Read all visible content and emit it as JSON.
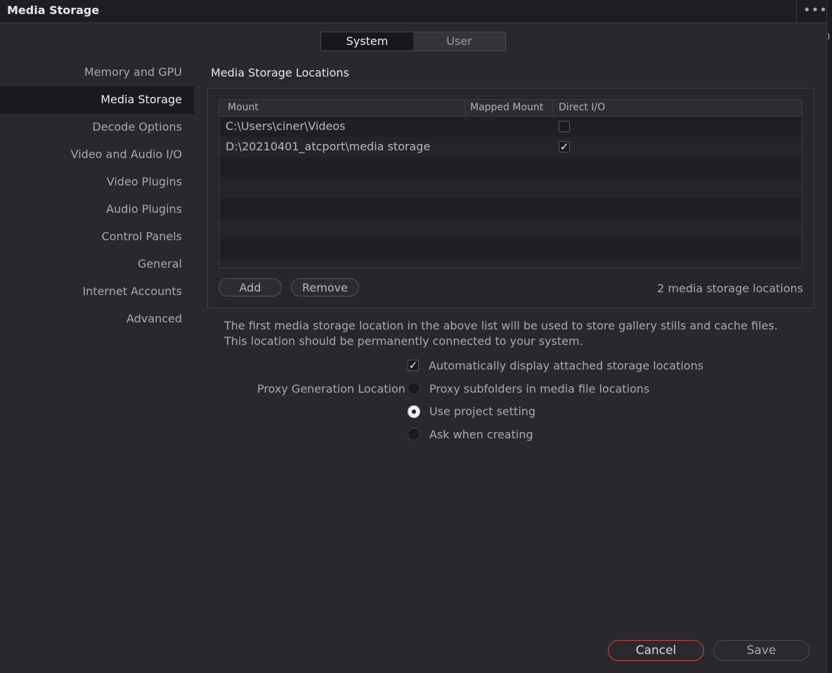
{
  "window": {
    "title": "Media Storage",
    "more_icon": "more-horizontal-icon",
    "edge_glyph": ")"
  },
  "tabs": [
    {
      "label": "System",
      "active": true
    },
    {
      "label": "User",
      "active": false
    }
  ],
  "sidebar": {
    "items": [
      {
        "label": "Memory and GPU"
      },
      {
        "label": "Media Storage",
        "active": true
      },
      {
        "label": "Decode Options"
      },
      {
        "label": "Video and Audio I/O"
      },
      {
        "label": "Video Plugins"
      },
      {
        "label": "Audio Plugins"
      },
      {
        "label": "Control Panels"
      },
      {
        "label": "General"
      },
      {
        "label": "Internet Accounts"
      },
      {
        "label": "Advanced"
      }
    ]
  },
  "main": {
    "section_title": "Media Storage Locations",
    "table": {
      "columns": [
        "Mount",
        "Mapped Mount",
        "Direct I/O"
      ],
      "rows": [
        {
          "mount": "C:\\Users\\ciner\\Videos",
          "mapped_mount": "",
          "direct_io": false
        },
        {
          "mount": "D:\\20210401_atcport\\media storage",
          "mapped_mount": "",
          "direct_io": true
        }
      ]
    },
    "add_label": "Add",
    "remove_label": "Remove",
    "count_text": "2 media storage locations",
    "note": "The first media storage location in the above list will be used to store gallery stills and cache files. This location should be permanently connected to your system.",
    "auto_display": {
      "label": "Automatically display attached storage locations",
      "checked": true
    },
    "proxy": {
      "label": "Proxy Generation Location",
      "options": [
        {
          "label": "Proxy subfolders in media file locations",
          "selected": false
        },
        {
          "label": "Use project setting",
          "selected": true
        },
        {
          "label": "Ask when creating",
          "selected": false
        }
      ]
    }
  },
  "footer": {
    "cancel_label": "Cancel",
    "save_label": "Save"
  },
  "colors": {
    "accent_cancel": "#d24a44",
    "background": "#28282e"
  }
}
